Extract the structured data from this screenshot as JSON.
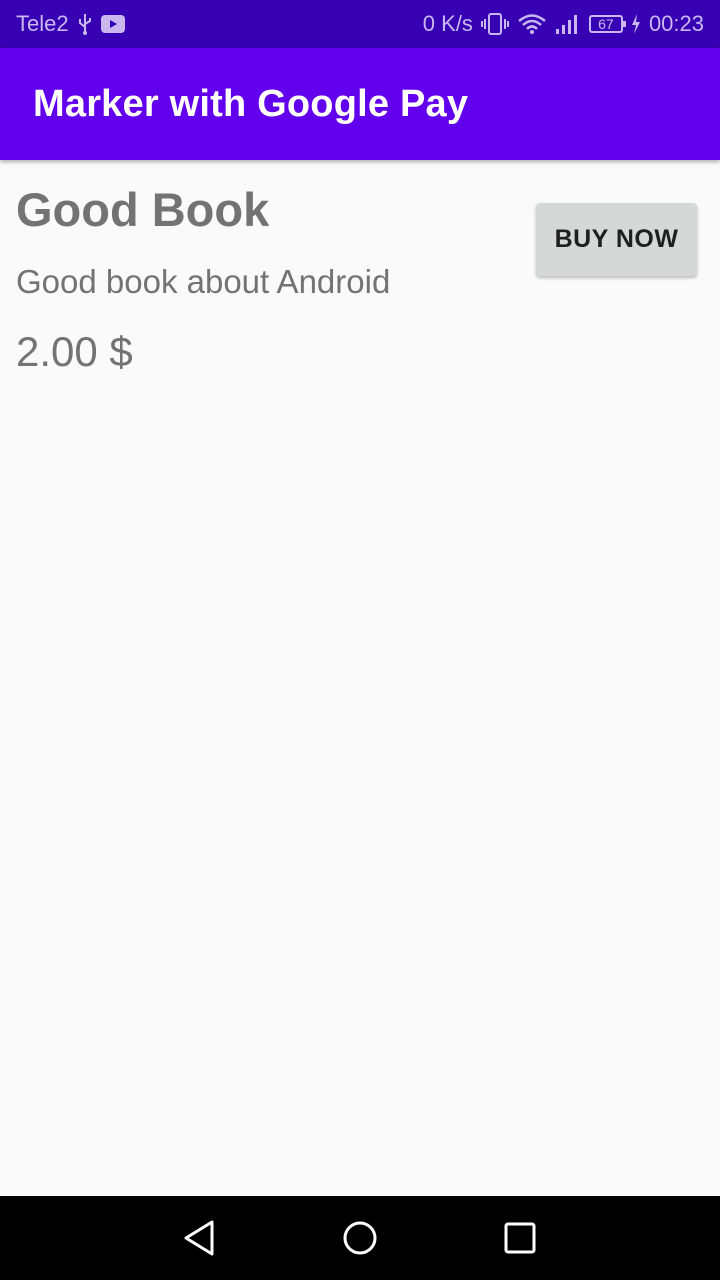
{
  "status_bar": {
    "carrier": "Tele2",
    "net_speed": "0 K/s",
    "battery_level": "67",
    "time": "00:23",
    "icons": [
      "usb-icon",
      "youtube-icon",
      "vibrate-icon",
      "wifi-icon",
      "signal-icon",
      "battery-icon",
      "charging-icon"
    ]
  },
  "app_bar": {
    "title": "Marker with Google Pay",
    "color": "#6200ee"
  },
  "product": {
    "title": "Good Book",
    "description": "Good book about Android",
    "price": "2.00 $"
  },
  "buy_button": {
    "label": "BUY NOW"
  },
  "nav_bar": {
    "icons": [
      "back-icon",
      "home-icon",
      "recents-icon"
    ]
  }
}
